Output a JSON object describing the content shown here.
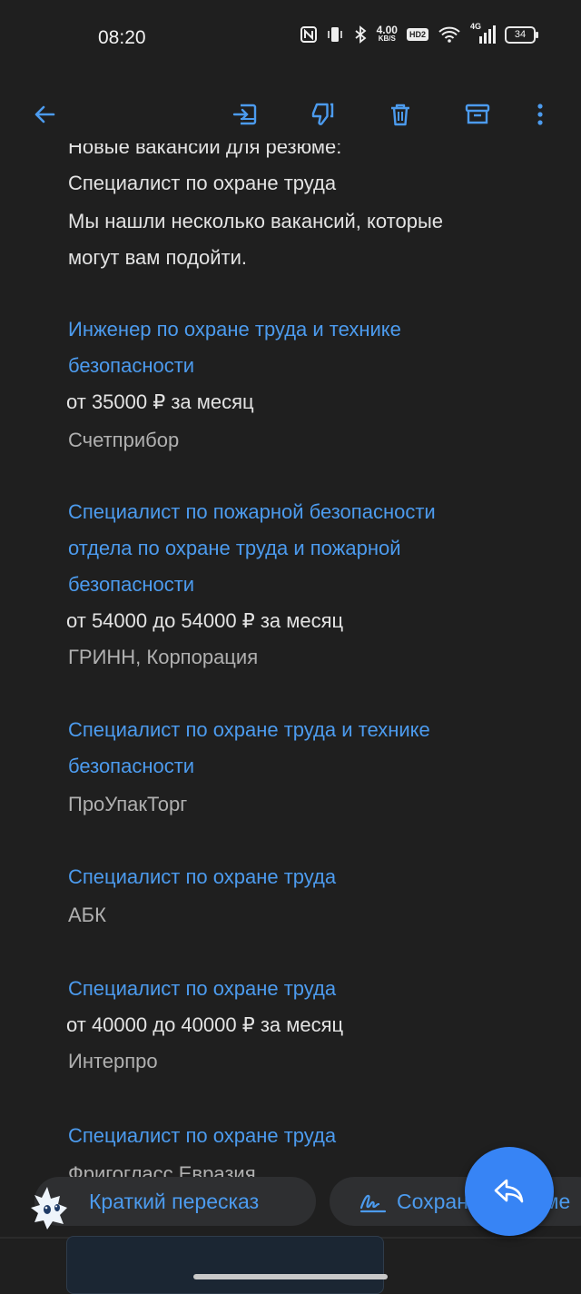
{
  "status": {
    "time": "08:20",
    "net_speed_top": "4.00",
    "net_speed_unit": "KB/S",
    "hd": "HD2",
    "net_type": "4G",
    "battery": "34"
  },
  "toolbar": {
    "icons": [
      "back-arrow-icon",
      "move-to-inbox-icon",
      "thumbs-down-icon",
      "trash-icon",
      "archive-icon",
      "more-vert-icon"
    ]
  },
  "email": {
    "cut_line": "Новые вакансии для резюме:",
    "position": "Специалист по охране труда",
    "intro": [
      "Мы нашли несколько вакансий, которые",
      "могут вам подойти."
    ],
    "vacancies": [
      {
        "title_lines": [
          "Инженер по охране труда и технике",
          "безопасности"
        ],
        "salary": "от 35000 ₽ за месяц",
        "company": "Счетприбор"
      },
      {
        "title_lines": [
          "Специалист по пожарной безопасности",
          "отдела по охране труда и пожарной",
          "безопасности"
        ],
        "salary": "от 54000 до 54000 ₽ за месяц",
        "company": "ГРИНН, Корпорация"
      },
      {
        "title_lines": [
          "Специалист по охране труда и технике",
          "безопасности"
        ],
        "salary": "",
        "company": "ПроУпакТорг"
      },
      {
        "title_lines": [
          "Специалист по охране труда"
        ],
        "salary": "",
        "company": "АБК"
      },
      {
        "title_lines": [
          "Специалист по охране труда"
        ],
        "salary": "от 40000 до 40000 ₽ за месяц",
        "company": "Интерпро"
      },
      {
        "title_lines": [
          "Специалист по охране труда"
        ],
        "salary": "",
        "company": "Фригогласс Евразия"
      }
    ]
  },
  "chips": {
    "summary": "Краткий пересказ",
    "save": "Сохранить в заме"
  },
  "colors": {
    "background": "#1f1f1f",
    "link": "#4c9bee",
    "fab": "#3784f5"
  }
}
